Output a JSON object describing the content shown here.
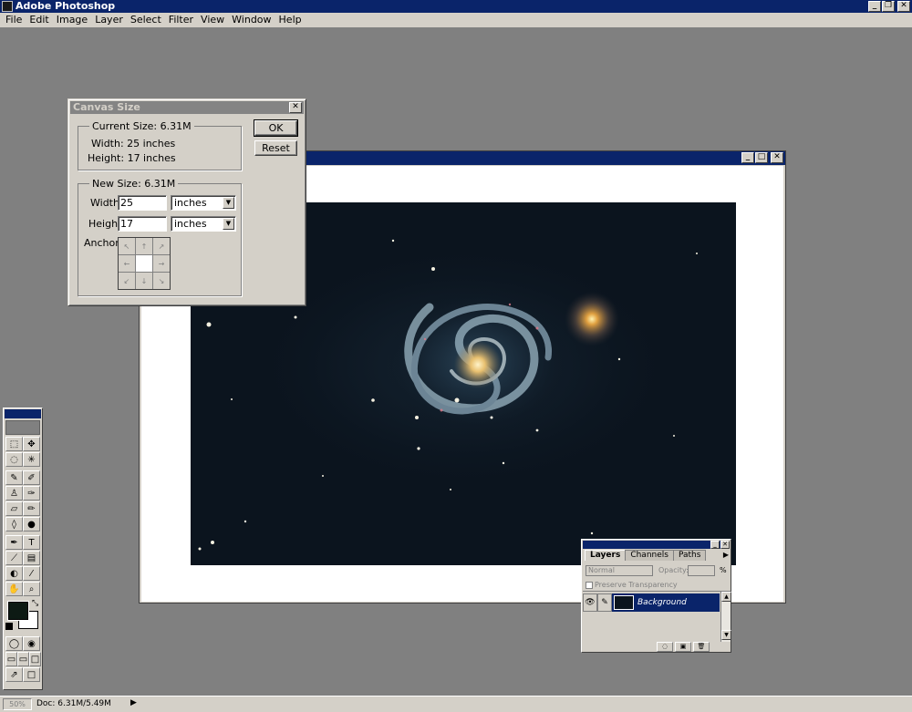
{
  "app": {
    "title": "Adobe Photoshop",
    "min": "_",
    "restore": "❐",
    "close": "✕"
  },
  "menu": {
    "items": [
      "File",
      "Edit",
      "Image",
      "Layer",
      "Select",
      "Filter",
      "View",
      "Window",
      "Help"
    ]
  },
  "document": {
    "min": "_",
    "max": "□",
    "close": "✕"
  },
  "dialog": {
    "title": "Canvas Size",
    "close": "✕",
    "current_legend": "Current Size:  6.31M",
    "current_width": "Width:  25 inches",
    "current_height": "Height:  17 inches",
    "new_legend": "New Size:  6.31M",
    "width_label": "Width:",
    "height_label": "Height:",
    "width_value": "25",
    "height_value": "17",
    "width_unit": "inches",
    "height_unit": "inches",
    "anchor_label": "Anchor:",
    "ok_label": "OK",
    "reset_label": "Reset"
  },
  "layers": {
    "tabs": [
      "Layers",
      "Channels",
      "Paths"
    ],
    "blend_mode": "Normal",
    "opacity_label": "Opacity:",
    "opacity_unit": "%",
    "preserve_label": "Preserve Transparency",
    "layer_name": "Background"
  },
  "status": {
    "zoom": "50%",
    "doc_info": "Doc: 6.31M/5.49M"
  },
  "colors": {
    "titlebar": "#0a246a",
    "chrome": "#d4d0c8",
    "workspace": "#808080",
    "foreground": "#0d1a14",
    "background": "#ffffff"
  }
}
